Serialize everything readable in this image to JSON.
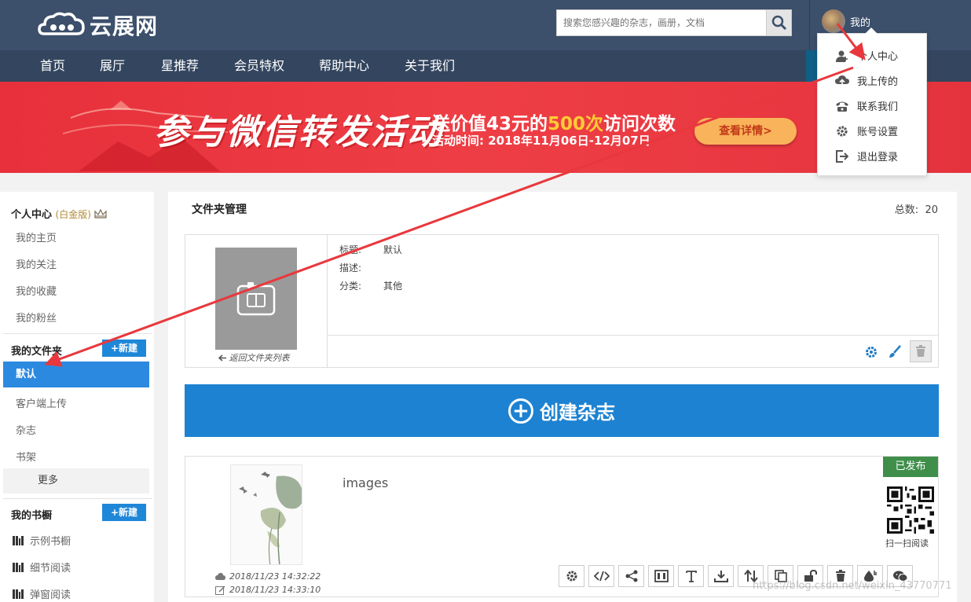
{
  "header": {
    "logo_text": "云展网",
    "search_placeholder": "搜索您感兴趣的杂志，画册，文档",
    "user_name": "我的"
  },
  "nav": {
    "items": [
      {
        "label": "首页"
      },
      {
        "label": "展厅"
      },
      {
        "label": "星推荐"
      },
      {
        "label": "会员特权"
      },
      {
        "label": "帮助中心"
      },
      {
        "label": "关于我们"
      }
    ]
  },
  "banner": {
    "headline": "参与微信转发活动",
    "line1_prefix": "送价值43元的",
    "line1_highlight": "500次",
    "line1_suffix": "访问次数",
    "line2": "活动时间: 2018年11月06日-12月07日",
    "button_label": "查看详情>"
  },
  "user_menu": {
    "items": [
      {
        "label": "个人中心",
        "icon": "user-icon"
      },
      {
        "label": "我上传的",
        "icon": "cloud-upload-icon"
      },
      {
        "label": "联系我们",
        "icon": "phone-icon"
      },
      {
        "label": "账号设置",
        "icon": "gear-icon"
      },
      {
        "label": "退出登录",
        "icon": "logout-icon"
      }
    ]
  },
  "sidebar": {
    "center_title": "个人中心",
    "center_tag": "(白金版)",
    "center_items": [
      {
        "label": "我的主页"
      },
      {
        "label": "我的关注"
      },
      {
        "label": "我的收藏"
      },
      {
        "label": "我的粉丝"
      }
    ],
    "folders_title": "我的文件夹",
    "new_label": "+新建",
    "folder_active": "默认",
    "folder_items": [
      {
        "label": "客户端上传"
      },
      {
        "label": "杂志"
      },
      {
        "label": "书架"
      }
    ],
    "more_label": "更多",
    "shelf_title": "我的书橱",
    "shelf_new_label": "+新建",
    "shelf_items": [
      {
        "label": "示例书橱"
      },
      {
        "label": "细节阅读"
      },
      {
        "label": "弹窗阅读"
      }
    ]
  },
  "main": {
    "title": "文件夹管理",
    "total_label": "总数:",
    "total_value": "20",
    "folder": {
      "back_label": "返回文件夹列表",
      "title_key": "标题:",
      "title_value": "默认",
      "desc_key": "描述:",
      "desc_value": "",
      "category_key": "分类:",
      "category_value": "其他"
    },
    "create_label": "创建杂志",
    "magazine": {
      "title": "images",
      "status": "已发布",
      "qr_label": "扫一扫阅读",
      "created": "2018/11/23 14:32:22",
      "modified": "2018/11/23 14:33:10"
    }
  },
  "watermark": "https://blog.csdn.net/weixin_43770771",
  "colors": {
    "header_bg": "#3c4f6b",
    "nav_bg": "#34465f",
    "banner_bg": "#e7303b",
    "accent_blue": "#1d82d1",
    "published_green": "#3f8f4a",
    "annotation_arrow": "#e8383d"
  }
}
